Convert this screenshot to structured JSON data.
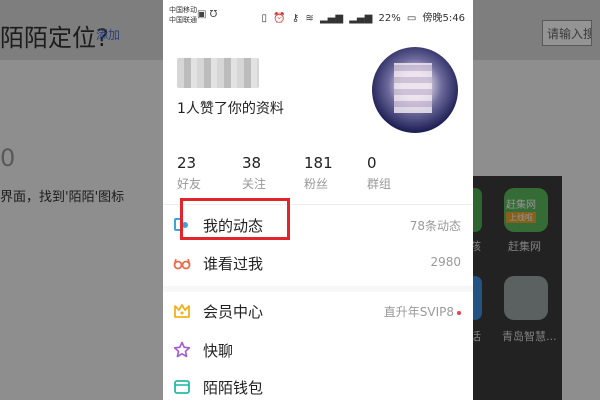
{
  "background": {
    "title": "陌陌定位?",
    "tab_text": "添加",
    "search_label": "请输入搜",
    "zero": "0",
    "hint_text": "界面，找到'陌陌'图标",
    "apps": [
      {
        "label": "孩"
      },
      {
        "label": "赶集网",
        "icon_text": "赶集网",
        "tag": "上线啦"
      },
      {
        "label": "话"
      },
      {
        "label": "青岛智慧..."
      }
    ]
  },
  "status_bar": {
    "carrier_1": "中国移动",
    "carrier_2": "中国联通",
    "battery": "22%",
    "time_prefix": "傍晚",
    "time": "5:46"
  },
  "profile": {
    "likes_text": "1人赞了你的资料"
  },
  "stats": [
    {
      "value": "23",
      "label": "好友"
    },
    {
      "value": "38",
      "label": "关注"
    },
    {
      "value": "181",
      "label": "粉丝"
    },
    {
      "value": "0",
      "label": "群组"
    }
  ],
  "menu": [
    {
      "label": "我的动态",
      "value": "78条动态",
      "icon": "feed-icon",
      "color": "#3aa6d8"
    },
    {
      "label": "谁看过我",
      "value": "2980",
      "icon": "glasses-icon",
      "color": "#ef6a4a"
    },
    {
      "label": "会员中心",
      "value": "直升年SVIP8",
      "icon": "crown-icon",
      "color": "#f2b01d"
    },
    {
      "label": "快聊",
      "value": "",
      "icon": "star-icon",
      "color": "#a25bd6"
    },
    {
      "label": "陌陌钱包",
      "value": "",
      "icon": "wallet-icon",
      "color": "#27b9a8"
    }
  ],
  "colors": {
    "highlight": "#e2252b",
    "vip_dot": "#e8404e"
  }
}
